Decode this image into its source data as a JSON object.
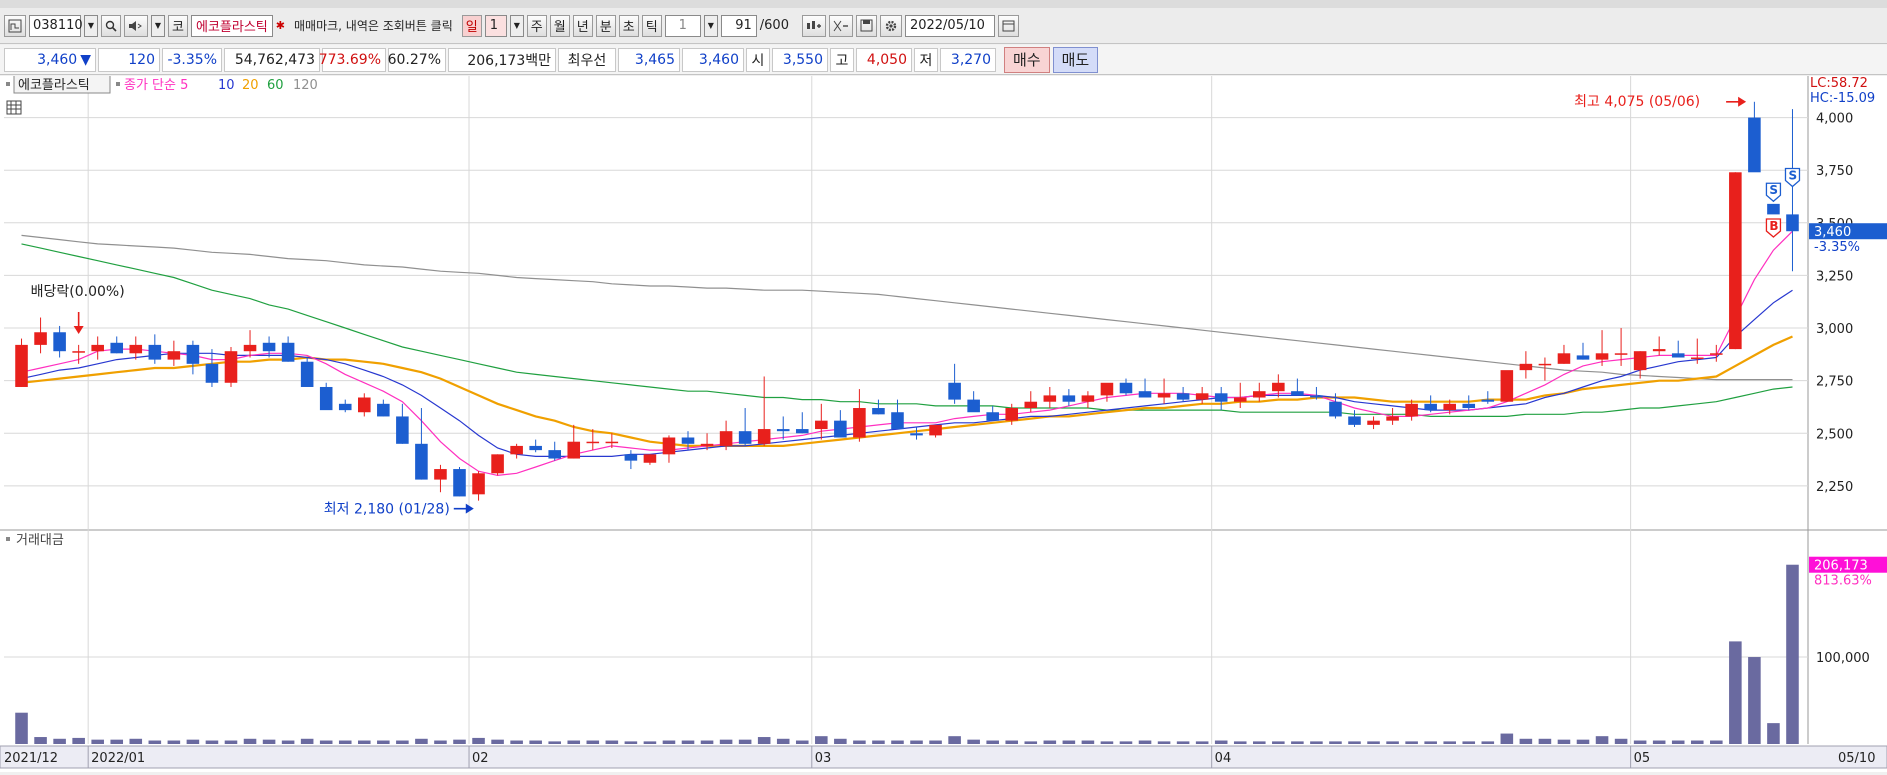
{
  "toolbar": {
    "code": "038110",
    "market_label": "코",
    "stock_name": "에코플라스틱",
    "memo_text": "매매마크, 내역은 조회버튼 클릭",
    "periods": [
      "일",
      "주",
      "월",
      "년",
      "분",
      "초",
      "틱"
    ],
    "period_value": "1",
    "tick_value": "1",
    "count": "91",
    "count_max": "/600",
    "date": "2022/05/10"
  },
  "quote": {
    "price": "3,460",
    "change": "120",
    "change_pct": "-3.35%",
    "volume": "54,762,473",
    "vol_ratio": "773.69%",
    "turnover": "60.27%",
    "amount": "206,173백만",
    "best_label": "최우선",
    "best_ask": "3,465",
    "best_bid": "3,460",
    "open_label": "시",
    "open": "3,550",
    "high_label": "고",
    "high": "4,050",
    "low_label": "저",
    "low": "3,270",
    "buy_label": "매수",
    "sell_label": "매도"
  },
  "colors": {
    "up": "#e8201c",
    "down": "#1c5ed0",
    "ma5": "#ff30c0",
    "ma10": "#2838d0",
    "ma20": "#f0a000",
    "ma60": "#20a040",
    "ma120": "#909090",
    "volume": "#6a6aa0"
  },
  "chart_data": {
    "type": "candlestick",
    "legend": {
      "name": "에코플라스틱",
      "ma_label": "종가 단순",
      "periods": [
        "5",
        "10",
        "20",
        "60",
        "120"
      ]
    },
    "ylim": [
      2050,
      4150
    ],
    "y_ticks": [
      "4,000",
      "3,750",
      "3,500",
      "3,250",
      "3,000",
      "2,750",
      "2,500",
      "2,250"
    ],
    "y_tick_values": [
      4000,
      3750,
      3500,
      3250,
      3000,
      2750,
      2500,
      2250
    ],
    "x_labels": [
      "2021/12",
      "2022/01",
      "02",
      "03",
      "04",
      "05",
      "05/10"
    ],
    "x_label_index": [
      0,
      4,
      24,
      42,
      63,
      85,
      93
    ],
    "lc_label": "LC:58.72",
    "hc_label": "HC:-15.09",
    "last_price_label": "3,460",
    "last_pct_label": "-3.35%",
    "annotations": {
      "dividend": "배당락(0.00%)",
      "high": "최고 4,075 (05/06)",
      "low": "최저 2,180 (01/28)"
    },
    "markers": [
      "S",
      "B",
      "S"
    ],
    "candles": [
      [
        2720,
        2950,
        2720,
        2920
      ],
      [
        2920,
        3050,
        2880,
        2980
      ],
      [
        2980,
        3010,
        2860,
        2890
      ],
      [
        2890,
        2920,
        2830,
        2890
      ],
      [
        2890,
        2960,
        2850,
        2920
      ],
      [
        2930,
        2960,
        2880,
        2880
      ],
      [
        2880,
        2960,
        2850,
        2920
      ],
      [
        2920,
        2970,
        2830,
        2850
      ],
      [
        2850,
        2940,
        2820,
        2890
      ],
      [
        2920,
        2940,
        2780,
        2830
      ],
      [
        2830,
        2900,
        2720,
        2740
      ],
      [
        2740,
        2910,
        2720,
        2890
      ],
      [
        2890,
        2990,
        2860,
        2920
      ],
      [
        2930,
        2960,
        2860,
        2890
      ],
      [
        2930,
        2960,
        2840,
        2840
      ],
      [
        2840,
        2860,
        2730,
        2720
      ],
      [
        2720,
        2740,
        2640,
        2610
      ],
      [
        2640,
        2660,
        2600,
        2610
      ],
      [
        2600,
        2690,
        2580,
        2670
      ],
      [
        2640,
        2660,
        2580,
        2580
      ],
      [
        2580,
        2640,
        2450,
        2450
      ],
      [
        2450,
        2620,
        2280,
        2280
      ],
      [
        2280,
        2350,
        2220,
        2330
      ],
      [
        2330,
        2340,
        2200,
        2200
      ],
      [
        2210,
        2320,
        2180,
        2310
      ],
      [
        2310,
        2400,
        2300,
        2400
      ],
      [
        2400,
        2450,
        2380,
        2440
      ],
      [
        2440,
        2470,
        2410,
        2420
      ],
      [
        2420,
        2460,
        2370,
        2380
      ],
      [
        2380,
        2540,
        2380,
        2460
      ],
      [
        2460,
        2520,
        2420,
        2460
      ],
      [
        2460,
        2500,
        2430,
        2460
      ],
      [
        2400,
        2420,
        2330,
        2370
      ],
      [
        2360,
        2400,
        2350,
        2400
      ],
      [
        2400,
        2490,
        2360,
        2480
      ],
      [
        2480,
        2510,
        2420,
        2450
      ],
      [
        2440,
        2500,
        2420,
        2450
      ],
      [
        2440,
        2560,
        2420,
        2510
      ],
      [
        2510,
        2620,
        2440,
        2450
      ],
      [
        2450,
        2770,
        2440,
        2520
      ],
      [
        2520,
        2580,
        2470,
        2510
      ],
      [
        2520,
        2600,
        2500,
        2500
      ],
      [
        2520,
        2640,
        2470,
        2560
      ],
      [
        2560,
        2610,
        2480,
        2480
      ],
      [
        2480,
        2710,
        2460,
        2620
      ],
      [
        2620,
        2660,
        2590,
        2590
      ],
      [
        2600,
        2660,
        2560,
        2520
      ],
      [
        2500,
        2530,
        2470,
        2490
      ],
      [
        2490,
        2540,
        2480,
        2540
      ],
      [
        2740,
        2830,
        2640,
        2660
      ],
      [
        2660,
        2700,
        2620,
        2600
      ],
      [
        2600,
        2630,
        2560,
        2560
      ],
      [
        2560,
        2640,
        2540,
        2620
      ],
      [
        2620,
        2700,
        2600,
        2650
      ],
      [
        2650,
        2720,
        2620,
        2680
      ],
      [
        2680,
        2710,
        2630,
        2650
      ],
      [
        2650,
        2700,
        2620,
        2680
      ],
      [
        2680,
        2730,
        2650,
        2740
      ],
      [
        2740,
        2760,
        2680,
        2690
      ],
      [
        2700,
        2760,
        2680,
        2670
      ],
      [
        2670,
        2760,
        2640,
        2690
      ],
      [
        2690,
        2720,
        2650,
        2660
      ],
      [
        2660,
        2720,
        2640,
        2690
      ],
      [
        2690,
        2720,
        2610,
        2650
      ],
      [
        2650,
        2740,
        2620,
        2670
      ],
      [
        2670,
        2740,
        2650,
        2700
      ],
      [
        2700,
        2780,
        2670,
        2740
      ],
      [
        2700,
        2760,
        2680,
        2680
      ],
      [
        2680,
        2720,
        2660,
        2670
      ],
      [
        2650,
        2690,
        2570,
        2580
      ],
      [
        2580,
        2610,
        2530,
        2540
      ],
      [
        2540,
        2580,
        2520,
        2560
      ],
      [
        2560,
        2620,
        2540,
        2580
      ],
      [
        2580,
        2660,
        2560,
        2640
      ],
      [
        2640,
        2680,
        2600,
        2610
      ],
      [
        2610,
        2660,
        2590,
        2640
      ],
      [
        2640,
        2680,
        2610,
        2620
      ],
      [
        2660,
        2700,
        2640,
        2650
      ],
      [
        2650,
        2790,
        2650,
        2800
      ],
      [
        2800,
        2890,
        2760,
        2830
      ],
      [
        2830,
        2860,
        2750,
        2830
      ],
      [
        2830,
        2920,
        2830,
        2880
      ],
      [
        2870,
        2930,
        2850,
        2850
      ],
      [
        2850,
        2990,
        2820,
        2880
      ],
      [
        2880,
        3000,
        2820,
        2880
      ],
      [
        2800,
        2890,
        2760,
        2890
      ],
      [
        2890,
        2960,
        2870,
        2900
      ],
      [
        2880,
        2940,
        2870,
        2860
      ],
      [
        2860,
        2950,
        2830,
        2860
      ],
      [
        2880,
        2920,
        2840,
        2880
      ],
      [
        2900,
        3740,
        2900,
        3740
      ],
      [
        4000,
        4075,
        3760,
        3740
      ],
      [
        3590,
        3650,
        3600,
        3540
      ],
      [
        3540,
        4040,
        3270,
        3460
      ]
    ],
    "ma5": [
      2790,
      2810,
      2830,
      2850,
      2890,
      2900,
      2900,
      2890,
      2880,
      2870,
      2850,
      2850,
      2870,
      2880,
      2880,
      2870,
      2830,
      2780,
      2740,
      2700,
      2650,
      2560,
      2460,
      2380,
      2320,
      2300,
      2310,
      2340,
      2370,
      2400,
      2420,
      2440,
      2430,
      2420,
      2420,
      2430,
      2440,
      2450,
      2460,
      2470,
      2480,
      2490,
      2510,
      2520,
      2530,
      2540,
      2550,
      2550,
      2550,
      2570,
      2580,
      2590,
      2590,
      2600,
      2610,
      2630,
      2650,
      2670,
      2680,
      2690,
      2690,
      2690,
      2680,
      2670,
      2670,
      2680,
      2690,
      2690,
      2680,
      2650,
      2620,
      2600,
      2580,
      2580,
      2590,
      2600,
      2610,
      2620,
      2650,
      2690,
      2730,
      2780,
      2820,
      2840,
      2850,
      2860,
      2870,
      2870,
      2870,
      2870,
      3050,
      3230,
      3370,
      3460
    ],
    "ma10": [
      2760,
      2780,
      2800,
      2810,
      2830,
      2850,
      2860,
      2870,
      2880,
      2880,
      2880,
      2870,
      2870,
      2870,
      2870,
      2860,
      2850,
      2830,
      2800,
      2770,
      2730,
      2680,
      2620,
      2560,
      2490,
      2430,
      2400,
      2390,
      2390,
      2390,
      2390,
      2390,
      2400,
      2400,
      2410,
      2420,
      2430,
      2440,
      2440,
      2450,
      2460,
      2470,
      2480,
      2490,
      2500,
      2510,
      2520,
      2530,
      2540,
      2550,
      2550,
      2560,
      2570,
      2580,
      2580,
      2590,
      2600,
      2610,
      2620,
      2630,
      2640,
      2650,
      2660,
      2670,
      2670,
      2680,
      2680,
      2680,
      2680,
      2670,
      2650,
      2640,
      2630,
      2620,
      2610,
      2610,
      2610,
      2620,
      2630,
      2640,
      2670,
      2690,
      2720,
      2750,
      2770,
      2800,
      2820,
      2840,
      2850,
      2860,
      2960,
      3040,
      3120,
      3180
    ],
    "ma20": [
      2740,
      2750,
      2760,
      2770,
      2780,
      2790,
      2800,
      2810,
      2810,
      2820,
      2830,
      2840,
      2840,
      2850,
      2850,
      2860,
      2850,
      2850,
      2840,
      2830,
      2810,
      2790,
      2760,
      2720,
      2680,
      2640,
      2610,
      2580,
      2560,
      2530,
      2510,
      2500,
      2480,
      2460,
      2450,
      2440,
      2440,
      2440,
      2440,
      2440,
      2440,
      2450,
      2460,
      2470,
      2480,
      2490,
      2500,
      2510,
      2520,
      2530,
      2540,
      2550,
      2560,
      2570,
      2580,
      2580,
      2590,
      2600,
      2610,
      2620,
      2620,
      2630,
      2640,
      2640,
      2650,
      2650,
      2660,
      2660,
      2670,
      2670,
      2670,
      2660,
      2650,
      2650,
      2650,
      2650,
      2650,
      2660,
      2660,
      2660,
      2680,
      2690,
      2710,
      2720,
      2730,
      2740,
      2750,
      2750,
      2760,
      2770,
      2820,
      2870,
      2920,
      2960
    ],
    "ma60": [
      3400,
      3380,
      3360,
      3340,
      3320,
      3300,
      3280,
      3260,
      3240,
      3210,
      3180,
      3160,
      3140,
      3110,
      3090,
      3060,
      3030,
      3000,
      2970,
      2940,
      2910,
      2890,
      2870,
      2850,
      2830,
      2810,
      2790,
      2780,
      2770,
      2760,
      2750,
      2740,
      2730,
      2720,
      2710,
      2700,
      2700,
      2690,
      2680,
      2670,
      2670,
      2660,
      2660,
      2650,
      2650,
      2640,
      2640,
      2640,
      2630,
      2630,
      2630,
      2630,
      2620,
      2620,
      2620,
      2620,
      2620,
      2610,
      2610,
      2610,
      2610,
      2610,
      2610,
      2610,
      2600,
      2600,
      2600,
      2600,
      2600,
      2600,
      2590,
      2590,
      2590,
      2590,
      2580,
      2580,
      2580,
      2580,
      2580,
      2590,
      2590,
      2590,
      2600,
      2600,
      2610,
      2620,
      2620,
      2630,
      2640,
      2650,
      2670,
      2690,
      2710,
      2720
    ],
    "ma120": [
      3440,
      3430,
      3420,
      3410,
      3400,
      3395,
      3390,
      3385,
      3380,
      3370,
      3360,
      3355,
      3350,
      3340,
      3330,
      3325,
      3320,
      3310,
      3300,
      3295,
      3290,
      3280,
      3270,
      3265,
      3260,
      3250,
      3240,
      3235,
      3230,
      3225,
      3220,
      3210,
      3205,
      3200,
      3200,
      3195,
      3190,
      3190,
      3185,
      3180,
      3180,
      3180,
      3175,
      3170,
      3165,
      3160,
      3150,
      3140,
      3130,
      3120,
      3110,
      3100,
      3090,
      3080,
      3070,
      3060,
      3050,
      3040,
      3030,
      3020,
      3010,
      3000,
      2990,
      2980,
      2970,
      2960,
      2950,
      2940,
      2930,
      2920,
      2910,
      2900,
      2890,
      2880,
      2870,
      2860,
      2850,
      2840,
      2830,
      2820,
      2810,
      2800,
      2795,
      2790,
      2780,
      2775,
      2770,
      2765,
      2760,
      2755,
      2755,
      2755,
      2755,
      2755
    ]
  },
  "volume_chart": {
    "title": "거래대금",
    "ylim": [
      0,
      230000
    ],
    "y_tick": "100,000",
    "y_tick_value": 100000,
    "last_value_label": "206,173",
    "last_pct_label": "813.63%",
    "values": [
      36000,
      8000,
      6000,
      7000,
      5000,
      5000,
      6000,
      4000,
      4000,
      5000,
      4000,
      4000,
      6000,
      5000,
      4000,
      6000,
      4000,
      4000,
      4000,
      4000,
      4000,
      6000,
      4000,
      5000,
      7000,
      5000,
      4000,
      4000,
      3000,
      4000,
      4000,
      4000,
      3000,
      3000,
      4000,
      4000,
      4000,
      5000,
      5000,
      8000,
      6000,
      4000,
      9000,
      6000,
      4000,
      4000,
      4000,
      4000,
      4000,
      9000,
      5000,
      4000,
      4000,
      3000,
      4000,
      4000,
      4000,
      3000,
      3000,
      4000,
      3000,
      3000,
      3000,
      4000,
      3000,
      3000,
      3000,
      3000,
      3000,
      3000,
      3000,
      3000,
      3000,
      3000,
      3000,
      3000,
      3000,
      3000,
      12000,
      6000,
      6000,
      5000,
      5000,
      9000,
      6000,
      4000,
      4000,
      4000,
      4000,
      4000,
      118000,
      100000,
      24000,
      206173
    ]
  }
}
